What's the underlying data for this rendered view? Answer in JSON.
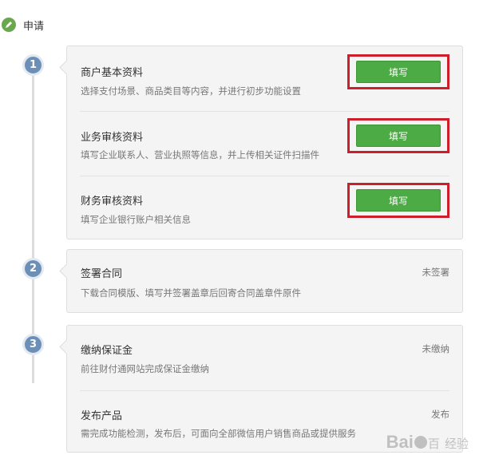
{
  "header": {
    "title": "申请",
    "icon": "pencil-icon"
  },
  "steps": [
    {
      "number": "1"
    },
    {
      "number": "2"
    },
    {
      "number": "3"
    }
  ],
  "step1": {
    "rows": [
      {
        "title": "商户基本资料",
        "desc": "选择支付场景、商品类目等内容，并进行初步功能设置",
        "button": "填写"
      },
      {
        "title": "业务审核资料",
        "desc": "填写企业联系人、营业执照等信息，并上传相关证件扫描件",
        "button": "填写"
      },
      {
        "title": "财务审核资料",
        "desc": "填写企业银行账户相关信息",
        "button": "填写"
      }
    ]
  },
  "step2": {
    "rows": [
      {
        "title": "签署合同",
        "desc": "下载合同模版、填写并签署盖章后回寄合同盖章件原件",
        "status": "未签署"
      }
    ]
  },
  "step3": {
    "rows": [
      {
        "title": "缴纳保证金",
        "desc": "前往财付通网站完成保证金缴纳",
        "status": "未缴纳"
      },
      {
        "title": "发布产品",
        "desc": "需完成功能检测，发布后，可面向全部微信用户销售商品或提供服务",
        "status": "发布"
      }
    ]
  },
  "watermark": {
    "brand": "Bai",
    "brand2": "百",
    "brand3": "经验"
  },
  "colors": {
    "accent_green": "#4cab45",
    "highlight_red": "#cc1f2b",
    "step_blue": "#6b8fb6"
  }
}
